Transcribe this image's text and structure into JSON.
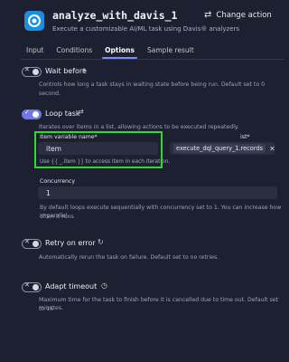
{
  "header": {
    "title": "analyze_with_davis_1",
    "subtitle": "Execute a customizable AI/ML task using Davis® analyzers",
    "change_action": "Change action"
  },
  "tabs": [
    {
      "label": "Input"
    },
    {
      "label": "Conditions"
    },
    {
      "label": "Options"
    },
    {
      "label": "Sample result"
    }
  ],
  "options": {
    "wait_before": {
      "label": "Wait before",
      "description": "Controls how long a task stays in waiting state before being run. Default set to 0 second."
    },
    "loop_task": {
      "label": "Loop task",
      "description": "Iterates over items in a list, allowing actions to be executed repeatedly.",
      "item_var_label": "Item variable name*",
      "item_var_value": "item",
      "item_var_help": "Use {{ _.item }} to access item in each iteration.",
      "list_label_fragment": "ist*",
      "list_value": "execute_dql_query_1.records",
      "concurrency_label": "Concurrency",
      "concurrency_value": "1",
      "concurrency_help_1": "By default loops execute sequentially with concurrency set to 1. You can increase how often it runs",
      "concurrency_help_2": "in parallel."
    },
    "retry_on_error": {
      "label": "Retry on error",
      "description": "Automatically rerun the task on failure. Default set to no retries."
    },
    "adapt_timeout": {
      "label": "Adapt timeout",
      "description_1": "Maximum time for the task to finish before it is cancelled due to time out. Default set to 15",
      "description_2": "minutes."
    }
  }
}
